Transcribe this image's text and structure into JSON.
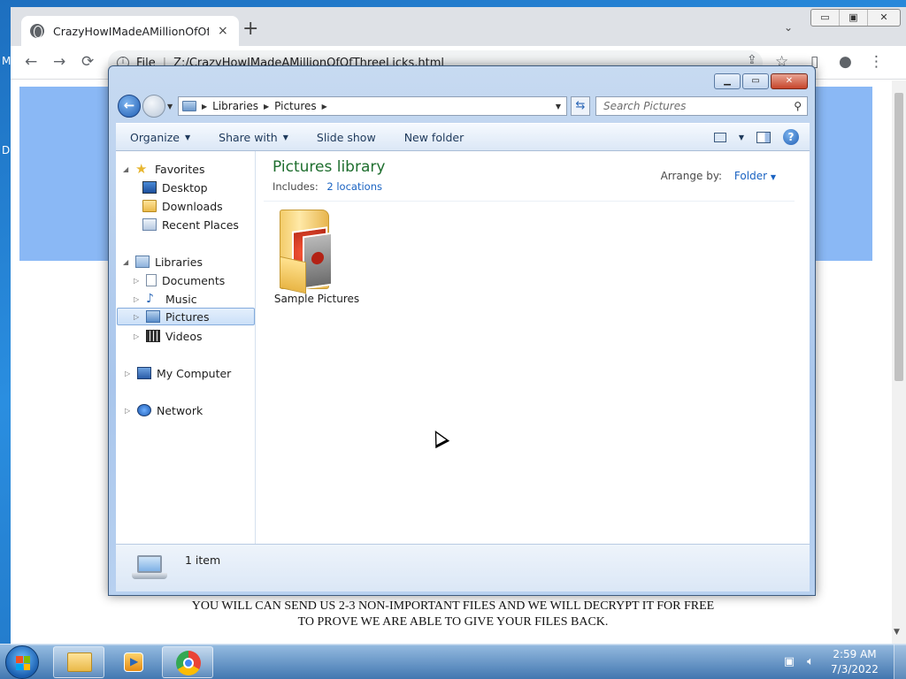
{
  "desktop": {
    "edge_chars": [
      "M",
      "D"
    ]
  },
  "chrome": {
    "tab_title": "CrazyHowIMadeAMillionOfOfThreeLicks.html",
    "tab_close": "×",
    "new_tab": "+",
    "tab_search": "⌄",
    "window_controls": [
      "▭",
      "▣",
      "✕"
    ],
    "back": "←",
    "forward": "→",
    "reload": "⟳",
    "url_scheme": "File",
    "url_path": "Z:/CrazyHowIMadeAMillionOfOfThreeLicks.html",
    "toolbar_icons": [
      "⇪",
      "☆",
      "▯",
      "●",
      "⋮"
    ],
    "page_text": "YOU WILL CAN SEND US 2-3 NON-IMPORTANT FILES AND WE WILL DECRYPT IT FOR FREE TO PROVE WE ARE ABLE TO GIVE YOUR FILES BACK.",
    "banner_color": "#8ab8f5"
  },
  "explorer": {
    "caption": {
      "minimize": "▁",
      "maximize": "▭",
      "close": "✕"
    },
    "breadcrumb": [
      "Libraries",
      "Pictures"
    ],
    "search_placeholder": "Search Pictures",
    "commands": [
      {
        "label": "Organize",
        "has_menu": true
      },
      {
        "label": "Share with",
        "has_menu": true
      },
      {
        "label": "Slide show",
        "has_menu": false
      },
      {
        "label": "New folder",
        "has_menu": false
      }
    ],
    "help": "?",
    "nav_tree": {
      "favorites": "Favorites",
      "desktop": "Desktop",
      "downloads": "Downloads",
      "recent_places": "Recent Places",
      "libraries": "Libraries",
      "documents": "Documents",
      "music": "Music",
      "pictures": "Pictures",
      "videos": "Videos",
      "my_computer": "My Computer",
      "network": "Network",
      "selected": "Pictures"
    },
    "library": {
      "title": "Pictures library",
      "includes_label": "Includes:",
      "includes_link": "2 locations",
      "arrange_label": "Arrange by:",
      "arrange_value": "Folder"
    },
    "items": [
      {
        "name": "Sample Pictures",
        "type": "folder"
      }
    ],
    "details": {
      "item_count": "1 item"
    }
  },
  "taskbar": {
    "pinned": [
      "windows-explorer",
      "windows-media-player",
      "google-chrome"
    ],
    "clock_time": "2:59 AM",
    "clock_date": "7/3/2022",
    "tray_icons": [
      "network-icon",
      "volume-icon"
    ]
  }
}
